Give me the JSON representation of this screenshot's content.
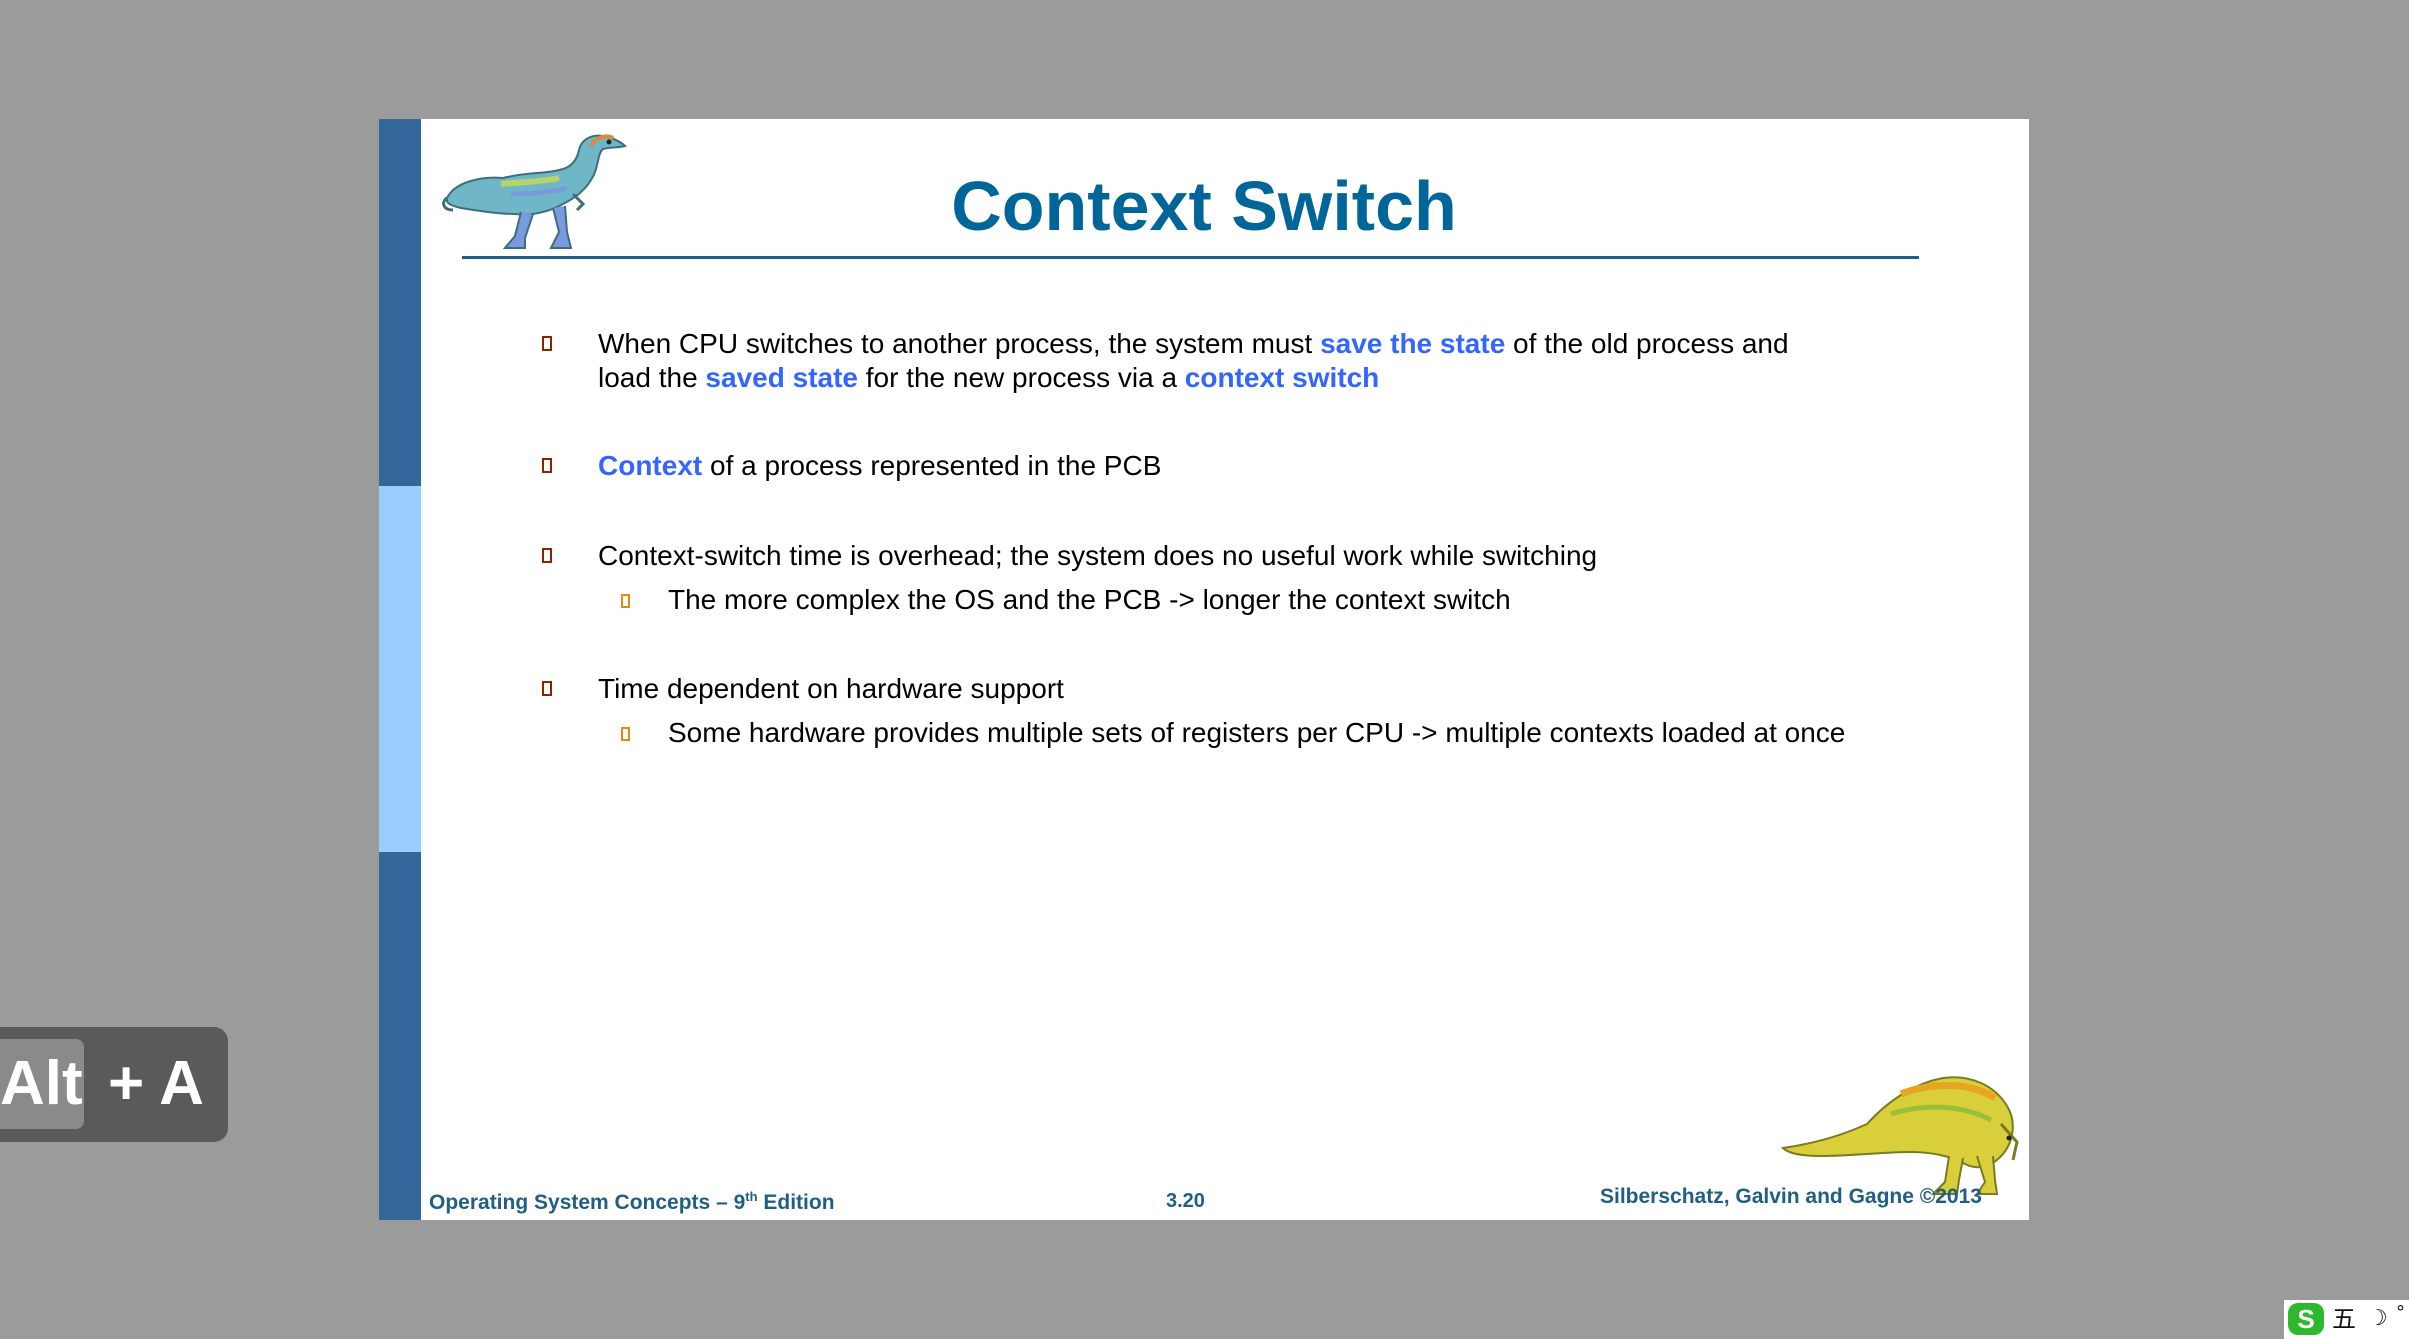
{
  "slide": {
    "title": "Context Switch",
    "bullets": [
      {
        "parts": [
          {
            "text": "When CPU switches to another process, the system must ",
            "highlight": false
          },
          {
            "text": "save the state",
            "highlight": true
          },
          {
            "text": " of the old process and load the ",
            "highlight": false
          },
          {
            "text": "saved state",
            "highlight": true
          },
          {
            "text": " for the new process via a ",
            "highlight": false
          },
          {
            "text": "context switch",
            "highlight": true
          }
        ],
        "subs": []
      },
      {
        "parts": [
          {
            "text": "Context",
            "highlight": true
          },
          {
            "text": " of a process represented in the PCB",
            "highlight": false
          }
        ],
        "subs": []
      },
      {
        "parts": [
          {
            "text": "Context-switch time is overhead; the system does no useful work while switching",
            "highlight": false
          }
        ],
        "subs": [
          "The more complex the OS and the PCB -> longer the context switch"
        ]
      },
      {
        "parts": [
          {
            "text": "Time dependent on hardware support",
            "highlight": false
          }
        ],
        "subs": [
          "Some hardware provides multiple sets of registers per CPU -> multiple contexts loaded at once"
        ]
      }
    ],
    "footer": {
      "left_pre": "Operating System Concepts – 9",
      "left_sup": "th",
      "left_post": " Edition",
      "page": "3.20",
      "right": "Silberschatz, Galvin and Gagne ©2013"
    }
  },
  "overlay": {
    "shortcut_key": "Alt",
    "shortcut_rest": "+ A"
  },
  "tray": {
    "logo": "S",
    "ime_mode": "五",
    "moon": "☽",
    "degree": "°"
  },
  "colors": {
    "title": "#006699",
    "highlight": "#3366ff",
    "bar_dark": "#336699",
    "bar_light": "#99ccff",
    "background": "#9b9b9b"
  }
}
